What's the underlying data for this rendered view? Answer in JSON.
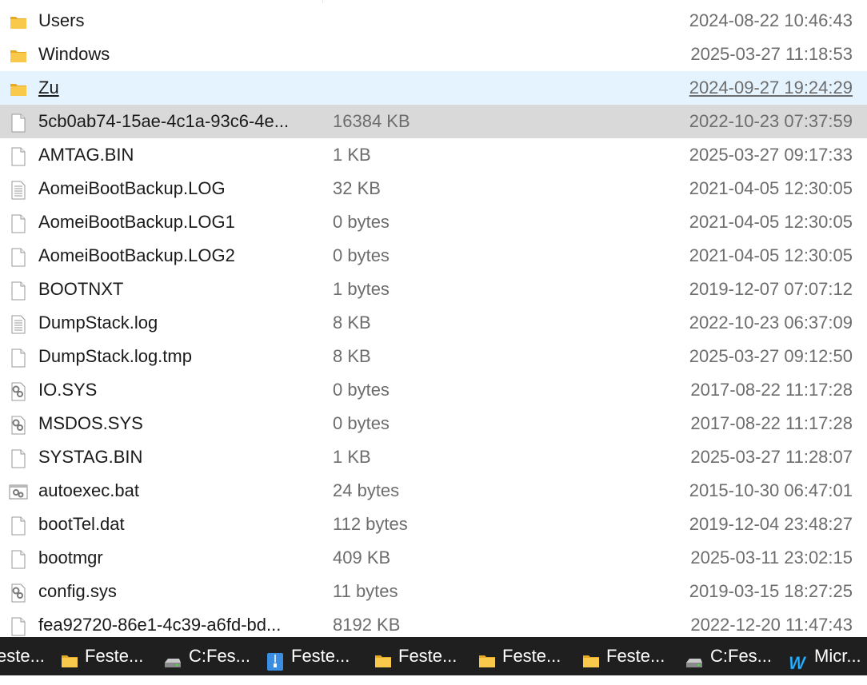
{
  "files": [
    {
      "name": "Users",
      "size": "",
      "date": "2024-08-22 10:46:43",
      "icon": "folder-icon",
      "state": ""
    },
    {
      "name": "Windows",
      "size": "",
      "date": "2025-03-27 11:18:53",
      "icon": "folder-icon",
      "state": ""
    },
    {
      "name": "Zu",
      "size": "",
      "date": "2024-09-27 19:24:29",
      "icon": "folder-icon",
      "state": "hover"
    },
    {
      "name": "5cb0ab74-15ae-4c1a-93c6-4e...",
      "size": "16384 KB",
      "date": "2022-10-23 07:37:59",
      "icon": "file-icon",
      "state": "selected"
    },
    {
      "name": "AMTAG.BIN",
      "size": "1 KB",
      "date": "2025-03-27 09:17:33",
      "icon": "file-icon",
      "state": ""
    },
    {
      "name": "AomeiBootBackup.LOG",
      "size": "32 KB",
      "date": "2021-04-05 12:30:05",
      "icon": "text-file-icon",
      "state": ""
    },
    {
      "name": "AomeiBootBackup.LOG1",
      "size": "0 bytes",
      "date": "2021-04-05 12:30:05",
      "icon": "file-icon",
      "state": ""
    },
    {
      "name": "AomeiBootBackup.LOG2",
      "size": "0 bytes",
      "date": "2021-04-05 12:30:05",
      "icon": "file-icon",
      "state": ""
    },
    {
      "name": "BOOTNXT",
      "size": "1 bytes",
      "date": "2019-12-07 07:07:12",
      "icon": "file-icon",
      "state": ""
    },
    {
      "name": "DumpStack.log",
      "size": "8 KB",
      "date": "2022-10-23 06:37:09",
      "icon": "text-file-icon",
      "state": ""
    },
    {
      "name": "DumpStack.log.tmp",
      "size": "8 KB",
      "date": "2025-03-27 09:12:50",
      "icon": "file-icon",
      "state": ""
    },
    {
      "name": "IO.SYS",
      "size": "0 bytes",
      "date": "2017-08-22 11:17:28",
      "icon": "system-file-icon",
      "state": ""
    },
    {
      "name": "MSDOS.SYS",
      "size": "0 bytes",
      "date": "2017-08-22 11:17:28",
      "icon": "system-file-icon",
      "state": ""
    },
    {
      "name": "SYSTAG.BIN",
      "size": "1 KB",
      "date": "2025-03-27 11:28:07",
      "icon": "file-icon",
      "state": ""
    },
    {
      "name": "autoexec.bat",
      "size": "24 bytes",
      "date": "2015-10-30 06:47:01",
      "icon": "batch-file-icon",
      "state": ""
    },
    {
      "name": "bootTel.dat",
      "size": "112 bytes",
      "date": "2019-12-04 23:48:27",
      "icon": "file-icon",
      "state": ""
    },
    {
      "name": "bootmgr",
      "size": "409 KB",
      "date": "2025-03-11 23:02:15",
      "icon": "file-icon",
      "state": ""
    },
    {
      "name": "config.sys",
      "size": "11 bytes",
      "date": "2019-03-15 18:27:25",
      "icon": "system-file-icon",
      "state": ""
    },
    {
      "name": "fea92720-86e1-4c39-a6fd-bd...",
      "size": "8192 KB",
      "date": "2022-12-20 11:47:43",
      "icon": "file-icon",
      "state": ""
    }
  ],
  "taskbar": [
    {
      "label": "este...",
      "icon": ""
    },
    {
      "label": "Feste...",
      "icon": "folder-icon"
    },
    {
      "label": "C:Fes...",
      "icon": "drive-icon"
    },
    {
      "label": "Feste...",
      "icon": "zip-folder-icon"
    },
    {
      "label": "Feste...",
      "icon": "folder-icon"
    },
    {
      "label": "Feste...",
      "icon": "folder-icon"
    },
    {
      "label": "Feste...",
      "icon": "folder-icon"
    },
    {
      "label": "C:Fes...",
      "icon": "drive-icon"
    },
    {
      "label": "Micr...",
      "icon": "winhex-icon"
    }
  ],
  "colors": {
    "hover": "#e5f3ff",
    "selected": "#d9d9d9",
    "taskbar": "#1f1f1f",
    "secondary_text": "#6d6d6d",
    "folder": "#f8c94a"
  }
}
